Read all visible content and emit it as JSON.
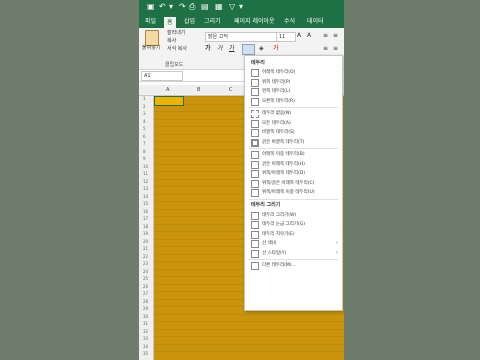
{
  "colors": {
    "excel_green": "#1e7145",
    "cell_fill": "#c9940b",
    "active_cell": "#f0b100"
  },
  "titlebar": {
    "icons": [
      "save-icon",
      "undo-icon",
      "redo-icon",
      "share-icon",
      "print-icon",
      "filter-icon",
      "dropdown-icon"
    ]
  },
  "tabs": [
    "파일",
    "홈",
    "삽입",
    "그리기",
    "페이지 레이아웃",
    "수식",
    "데이터"
  ],
  "ribbon": {
    "paste": "붙여넣기",
    "cut": "잘라내기",
    "copy": "복사",
    "format_painter": "서식 복사",
    "clipboard": "클립보드",
    "font_name": "맑은 고딕",
    "font_size": "11"
  },
  "formula_bar": {
    "name_box": "A1"
  },
  "columns": [
    "A",
    "B",
    "C"
  ],
  "rows": [
    "1",
    "2",
    "3",
    "4",
    "5",
    "6",
    "7",
    "8",
    "9",
    "10",
    "11",
    "12",
    "13",
    "14",
    "15",
    "16",
    "17",
    "18",
    "19",
    "20",
    "21",
    "22",
    "23",
    "24",
    "25",
    "26",
    "27",
    "28",
    "29",
    "30",
    "31",
    "32",
    "33",
    "34",
    "35"
  ],
  "menu": {
    "header_borders": "테두리",
    "items": [
      "아래쪽 테두리(O)",
      "위쪽 테두리(P)",
      "왼쪽 테두리(L)",
      "오른쪽 테두리(R)",
      "테두리 없음(N)",
      "모든 테두리(A)",
      "바깥쪽 테두리(S)",
      "굵은 바깥쪽 테두리(T)",
      "아래쪽 이중 테두리(B)",
      "굵은 아래쪽 테두리(H)",
      "위쪽/아래쪽 테두리(D)",
      "위쪽/굵은 아래쪽 테두리(C)",
      "위쪽/아래쪽 이중 테두리(U)"
    ],
    "header_draw": "테두리 그리기",
    "draw_items": [
      "테두리 그리기(W)",
      "테두리 눈금 그리기(G)",
      "테두리 지우기(E)",
      "선 색(I)",
      "선 스타일(Y)",
      "다른 테두리(M)..."
    ]
  }
}
